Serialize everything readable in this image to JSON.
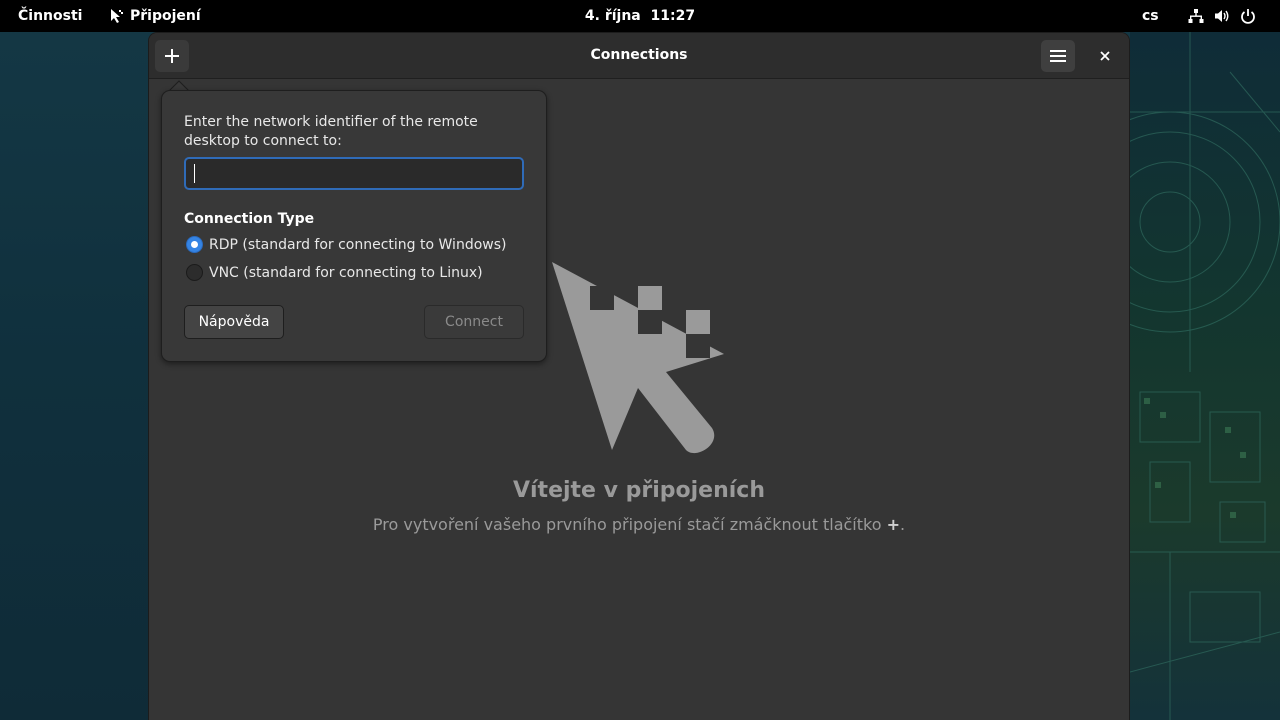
{
  "topbar": {
    "activities": "Činnosti",
    "app_name": "Připojení",
    "clock": "4. října  11:27",
    "language": "cs",
    "status_icons": [
      "network-icon",
      "volume-icon",
      "power-icon"
    ]
  },
  "window": {
    "title": "Connections",
    "add_icon": "plus-icon",
    "menu_icon": "hamburger-menu-icon",
    "close_icon": "close-icon"
  },
  "empty_state": {
    "title": "Vítejte v připojeních",
    "subtitle_prefix": "Pro vytvoření vašeho prvního připojení stačí zmáčknout tlačítko ",
    "subtitle_symbol": "+",
    "subtitle_suffix": "."
  },
  "popover": {
    "prompt": "Enter the network identifier of the remote desktop to connect to:",
    "address_value": "",
    "connection_type_label": "Connection Type",
    "options": [
      {
        "label": "RDP (standard for connecting to Windows)",
        "checked": true
      },
      {
        "label": "VNC (standard for connecting to Linux)",
        "checked": false
      }
    ],
    "help_button": "Nápověda",
    "connect_button": "Connect"
  },
  "colors": {
    "accent": "#3584e4",
    "window_bg": "#353535",
    "headerbar_bg": "#2d2d2d",
    "topbar_bg": "#000000"
  }
}
